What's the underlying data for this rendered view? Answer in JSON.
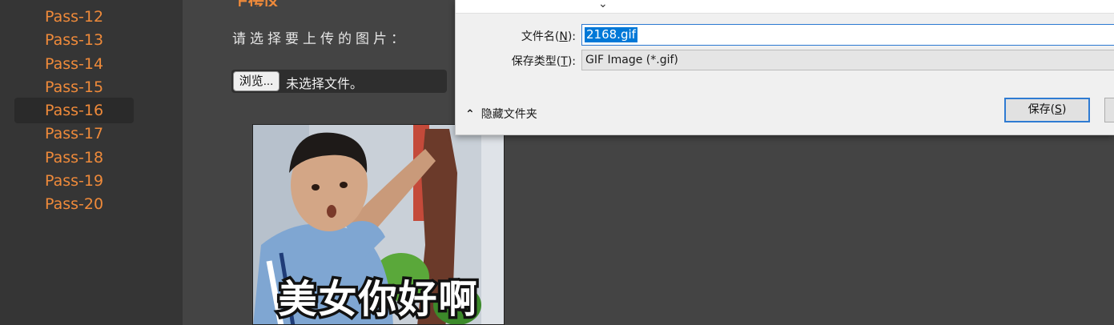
{
  "sidebar": {
    "items": [
      {
        "label": "Pass-12",
        "active": false
      },
      {
        "label": "Pass-13",
        "active": false
      },
      {
        "label": "Pass-14",
        "active": false
      },
      {
        "label": "Pass-15",
        "active": false
      },
      {
        "label": "Pass-16",
        "active": true
      },
      {
        "label": "Pass-17",
        "active": false
      },
      {
        "label": "Pass-18",
        "active": false
      },
      {
        "label": "Pass-19",
        "active": false
      },
      {
        "label": "Pass-20",
        "active": false
      }
    ]
  },
  "main": {
    "title": "上传区",
    "prompt": "请选择要上传的图片：",
    "browse_label": "浏览...",
    "no_file_text": "未选择文件。",
    "preview_caption": "美女你好啊"
  },
  "dialog": {
    "filename_label": "文件名",
    "filename_accel": "N",
    "filename_value": "2168.gif",
    "savetype_label": "保存类型",
    "savetype_accel": "T",
    "savetype_value": "GIF Image (*.gif)",
    "hide_folders_label": "隐藏文件夹",
    "save_label": "保存",
    "save_accel": "S"
  },
  "colors": {
    "accent_orange": "#ef8a3a",
    "selection_blue": "#0078d7"
  },
  "icons": {
    "top_chevron": "chevron-down-icon",
    "hide_folders": "chevron-up-icon"
  }
}
